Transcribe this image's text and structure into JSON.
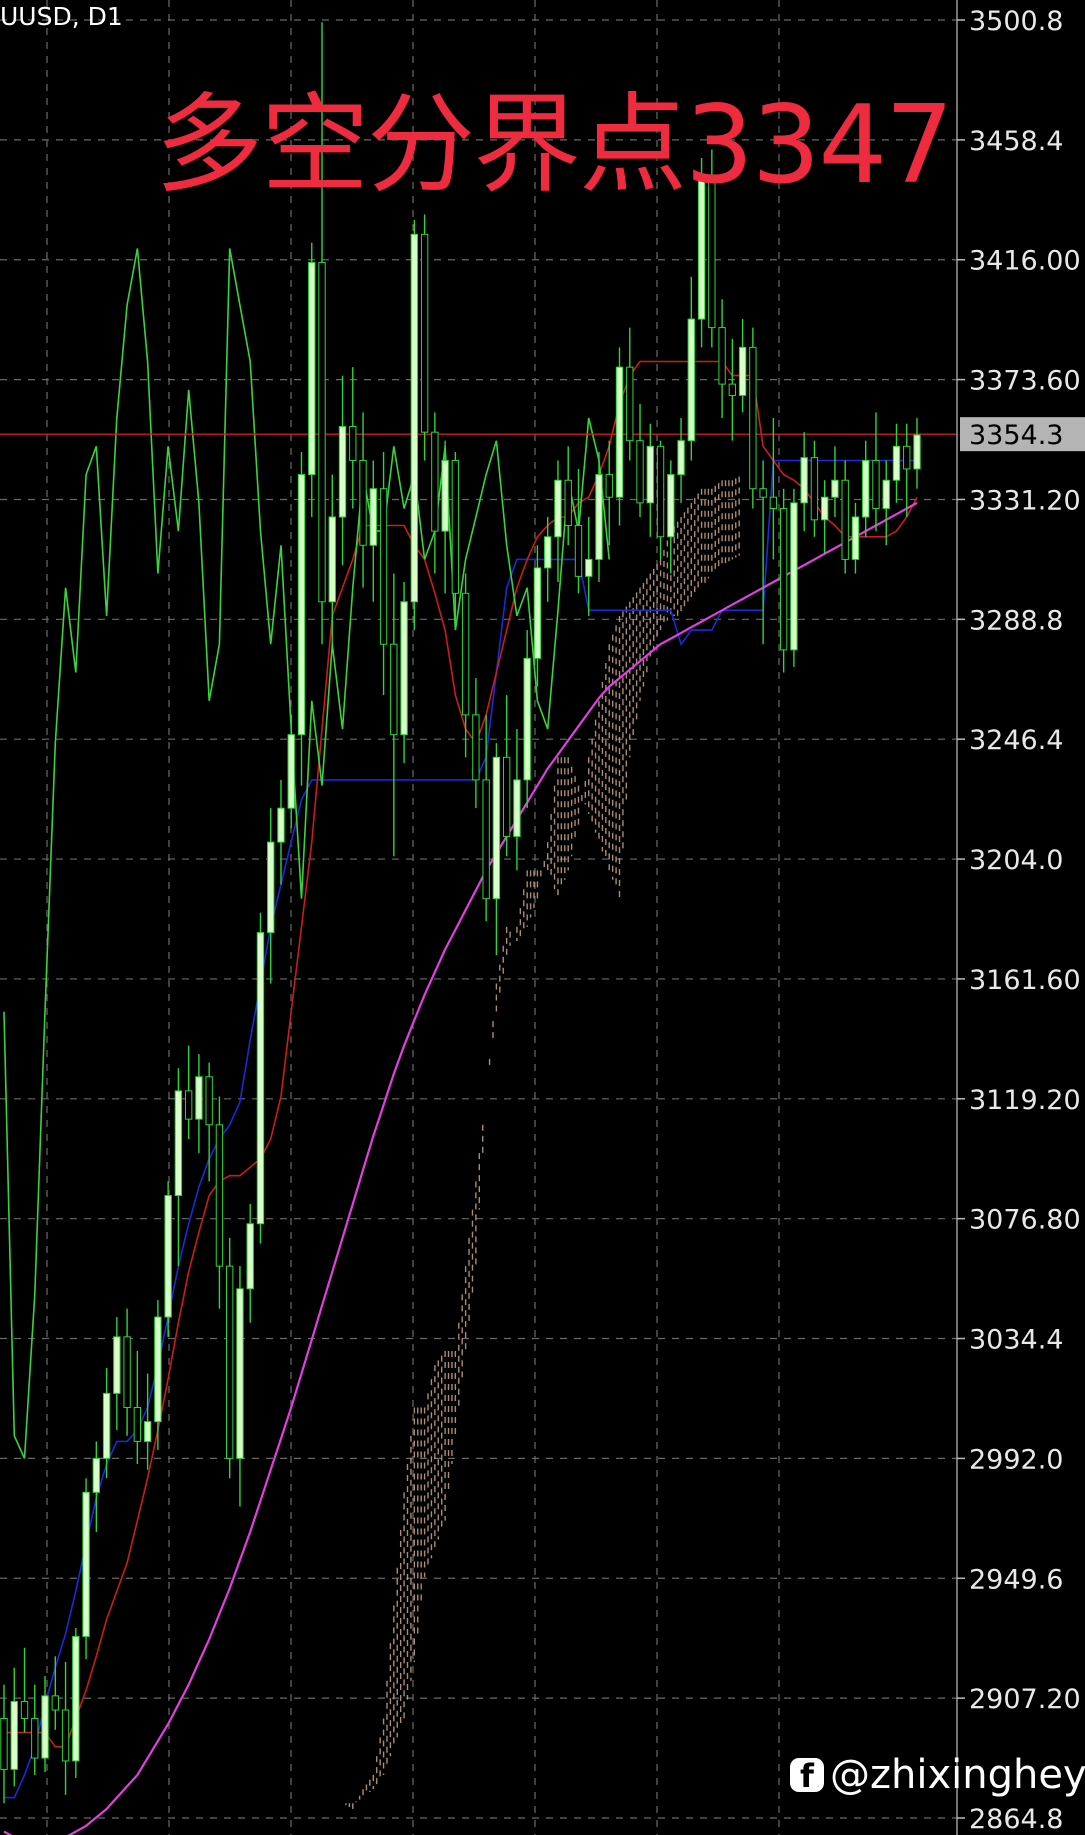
{
  "header": {
    "symbol": "UUSD, D1"
  },
  "annotation": {
    "headline": "多空分界点3347"
  },
  "watermark": {
    "icon": "facebook-icon",
    "handle": "@zhixingheyi"
  },
  "colors": {
    "background": "#000000",
    "grid": "#6a6a6a",
    "bull_candle": "#d8ffc8",
    "candle_wick": "#32d23c",
    "tenkan": "#1a2bd8",
    "kijun": "#c81e1e",
    "senkou_b": "#e040e0",
    "chikou": "#3cd23c",
    "cloud": "#c9a58c",
    "price_line": "#c81e1e",
    "headline": "#ee2b3f"
  },
  "chart_data": {
    "type": "candlestick",
    "timeframe": "D1",
    "ylim": [
      2864.8,
      3500.8
    ],
    "yticks": [
      "3500.8",
      "3458.4",
      "3416.00",
      "3373.60",
      "3331.20",
      "3288.8",
      "3246.4",
      "3204.0",
      "3161.60",
      "3119.20",
      "3076.80",
      "3034.4",
      "2992.0",
      "2949.6",
      "2907.20",
      "2864.8"
    ],
    "current_price_label": "3354.3",
    "current_price": 3354.3,
    "key_level": 3347,
    "candles": [
      [
        2900,
        2912,
        2870,
        2882
      ],
      [
        2882,
        2918,
        2876,
        2906
      ],
      [
        2906,
        2925,
        2895,
        2900
      ],
      [
        2900,
        2912,
        2880,
        2886
      ],
      [
        2886,
        2915,
        2881,
        2908
      ],
      [
        2908,
        2922,
        2896,
        2903
      ],
      [
        2903,
        2920,
        2873,
        2885
      ],
      [
        2885,
        2932,
        2879,
        2929
      ],
      [
        2929,
        2985,
        2921,
        2980
      ],
      [
        2980,
        2998,
        2966,
        2992
      ],
      [
        2992,
        3024,
        2985,
        3015
      ],
      [
        3015,
        3042,
        3002,
        3035
      ],
      [
        3035,
        3045,
        3000,
        3010
      ],
      [
        3010,
        3030,
        2990,
        2998
      ],
      [
        2998,
        3022,
        2988,
        3005
      ],
      [
        3005,
        3048,
        2995,
        3042
      ],
      [
        3042,
        3090,
        3035,
        3085
      ],
      [
        3085,
        3130,
        3060,
        3122
      ],
      [
        3122,
        3138,
        3105,
        3112
      ],
      [
        3112,
        3135,
        3100,
        3127
      ],
      [
        3127,
        3132,
        3090,
        3110
      ],
      [
        3110,
        3120,
        3045,
        3060
      ],
      [
        3060,
        3070,
        2985,
        2992
      ],
      [
        2992,
        3060,
        2975,
        3052
      ],
      [
        3052,
        3082,
        3040,
        3075
      ],
      [
        3075,
        3185,
        3068,
        3178
      ],
      [
        3178,
        3222,
        3160,
        3210
      ],
      [
        3210,
        3232,
        3195,
        3222
      ],
      [
        3222,
        3255,
        3215,
        3248
      ],
      [
        3248,
        3348,
        3230,
        3340
      ],
      [
        3340,
        3422,
        3325,
        3415
      ],
      [
        3415,
        3500,
        3280,
        3295
      ],
      [
        3295,
        3340,
        3278,
        3325
      ],
      [
        3325,
        3375,
        3308,
        3357
      ],
      [
        3357,
        3378,
        3328,
        3345
      ],
      [
        3345,
        3362,
        3300,
        3315
      ],
      [
        3315,
        3345,
        3295,
        3335
      ],
      [
        3335,
        3348,
        3262,
        3280
      ],
      [
        3280,
        3305,
        3205,
        3248
      ],
      [
        3248,
        3302,
        3238,
        3295
      ],
      [
        3295,
        3430,
        3285,
        3425
      ],
      [
        3425,
        3432,
        3345,
        3355
      ],
      [
        3355,
        3362,
        3305,
        3320
      ],
      [
        3320,
        3352,
        3298,
        3345
      ],
      [
        3345,
        3348,
        3288,
        3298
      ],
      [
        3298,
        3305,
        3240,
        3255
      ],
      [
        3255,
        3268,
        3222,
        3232
      ],
      [
        3232,
        3255,
        3182,
        3190
      ],
      [
        3190,
        3245,
        3170,
        3240
      ],
      [
        3240,
        3262,
        3205,
        3212
      ],
      [
        3212,
        3250,
        3200,
        3232
      ],
      [
        3232,
        3285,
        3222,
        3275
      ],
      [
        3275,
        3315,
        3265,
        3307
      ],
      [
        3307,
        3325,
        3295,
        3318
      ],
      [
        3318,
        3345,
        3302,
        3338
      ],
      [
        3338,
        3350,
        3315,
        3322
      ],
      [
        3322,
        3342,
        3298,
        3304
      ],
      [
        3304,
        3325,
        3290,
        3310
      ],
      [
        3310,
        3348,
        3302,
        3340
      ],
      [
        3340,
        3352,
        3315,
        3332
      ],
      [
        3332,
        3385,
        3322,
        3378
      ],
      [
        3378,
        3392,
        3345,
        3352
      ],
      [
        3352,
        3365,
        3325,
        3330
      ],
      [
        3330,
        3358,
        3318,
        3350
      ],
      [
        3350,
        3352,
        3310,
        3318
      ],
      [
        3318,
        3345,
        3305,
        3340
      ],
      [
        3340,
        3360,
        3330,
        3352
      ],
      [
        3352,
        3410,
        3345,
        3395
      ],
      [
        3395,
        3452,
        3385,
        3446
      ],
      [
        3446,
        3455,
        3385,
        3392
      ],
      [
        3392,
        3402,
        3360,
        3372
      ],
      [
        3372,
        3388,
        3352,
        3368
      ],
      [
        3368,
        3395,
        3362,
        3385
      ],
      [
        3385,
        3392,
        3328,
        3335
      ],
      [
        3335,
        3345,
        3280,
        3332
      ],
      [
        3332,
        3360,
        3310,
        3328
      ],
      [
        3328,
        3335,
        3270,
        3278
      ],
      [
        3278,
        3335,
        3272,
        3330
      ],
      [
        3330,
        3355,
        3320,
        3346
      ],
      [
        3346,
        3352,
        3318,
        3324
      ],
      [
        3324,
        3338,
        3312,
        3332
      ],
      [
        3332,
        3350,
        3325,
        3338
      ],
      [
        3338,
        3345,
        3305,
        3310
      ],
      [
        3310,
        3330,
        3305,
        3325
      ],
      [
        3325,
        3352,
        3318,
        3345
      ],
      [
        3345,
        3362,
        3320,
        3328
      ],
      [
        3328,
        3345,
        3315,
        3338
      ],
      [
        3338,
        3358,
        3330,
        3350
      ],
      [
        3350,
        3358,
        3325,
        3342
      ],
      [
        3342,
        3360,
        3335,
        3354
      ]
    ],
    "series": [
      {
        "key": "tenkan",
        "values": [
          2872,
          2872,
          2880,
          2890,
          2905,
          2918,
          2930,
          2945,
          2962,
          2978,
          2990,
          2998,
          2998,
          3002,
          3010,
          3025,
          3042,
          3060,
          3075,
          3088,
          3098,
          3105,
          3110,
          3118,
          3140,
          3160,
          3180,
          3195,
          3210,
          3225,
          3232,
          3232,
          3232,
          3232,
          3232,
          3232,
          3232,
          3232,
          3232,
          3232,
          3232,
          3232,
          3232,
          3232,
          3232,
          3232,
          3232,
          3240,
          3270,
          3300,
          3310,
          3310,
          3310,
          3310,
          3310,
          3310,
          3310,
          3292,
          3292,
          3292,
          3292,
          3292,
          3292,
          3292,
          3292,
          3292,
          3280,
          3285,
          3285,
          3285,
          3292,
          3292,
          3292,
          3292,
          3292,
          3345,
          3345,
          3345,
          3345,
          3345,
          3345,
          3345,
          3345,
          3345,
          3345,
          3345,
          3345,
          3345,
          3345,
          3345
        ]
      },
      {
        "key": "kijun",
        "values": [
          2895,
          2895,
          2895,
          2895,
          2895,
          2890,
          2890,
          2900,
          2910,
          2922,
          2935,
          2945,
          2955,
          2970,
          2985,
          3002,
          3020,
          3040,
          3058,
          3072,
          3085,
          3090,
          3092,
          3092,
          3095,
          3098,
          3105,
          3120,
          3150,
          3180,
          3210,
          3250,
          3290,
          3300,
          3310,
          3322,
          3322,
          3322,
          3322,
          3322,
          3315,
          3310,
          3298,
          3285,
          3262,
          3250,
          3245,
          3255,
          3270,
          3285,
          3300,
          3310,
          3318,
          3322,
          3325,
          3325,
          3330,
          3332,
          3340,
          3350,
          3365,
          3375,
          3380,
          3380,
          3380,
          3380,
          3380,
          3380,
          3380,
          3380,
          3380,
          3375,
          3375,
          3375,
          3350,
          3345,
          3340,
          3338,
          3335,
          3330,
          3325,
          3322,
          3318,
          3318,
          3318,
          3318,
          3318,
          3320,
          3325,
          3332
        ]
      },
      {
        "key": "senkou_b",
        "values": [
          2860,
          2858,
          2856,
          2855,
          2855,
          2856,
          2858,
          2860,
          2862,
          2865,
          2868,
          2872,
          2876,
          2880,
          2886,
          2892,
          2898,
          2905,
          2912,
          2920,
          2928,
          2937,
          2946,
          2956,
          2966,
          2977,
          2988,
          2999,
          3010,
          3022,
          3034,
          3046,
          3058,
          3070,
          3082,
          3094,
          3106,
          3117,
          3128,
          3138,
          3147,
          3156,
          3164,
          3172,
          3179,
          3186,
          3193,
          3200,
          3206,
          3212,
          3218,
          3224,
          3230,
          3236,
          3241,
          3246,
          3251,
          3256,
          3261,
          3265,
          3268,
          3271,
          3274,
          3277,
          3280,
          3282,
          3284,
          3286,
          3288,
          3290,
          3292,
          3294,
          3296,
          3298,
          3300,
          3302,
          3304,
          3306,
          3308,
          3310,
          3312,
          3314,
          3316,
          3318,
          3320,
          3322,
          3324,
          3326,
          3328,
          3330
        ]
      },
      {
        "key": "chikou",
        "values": [
          3150,
          3000,
          2992,
          3050,
          3150,
          3245,
          3300,
          3270,
          3340,
          3350,
          3290,
          3360,
          3400,
          3420,
          3380,
          3305,
          3350,
          3320,
          3370,
          3330,
          3260,
          3280,
          3420,
          3400,
          3380,
          3320,
          3280,
          3315,
          3250,
          3190,
          3260,
          3230,
          3280,
          3250,
          3300,
          3340,
          3320,
          3320,
          3350,
          3328,
          3340,
          3310,
          3320,
          3350,
          3285,
          3310,
          3325,
          3340,
          3352,
          3315,
          3290,
          3300,
          3260,
          3250,
          3292,
          3338,
          3320,
          3360,
          3345,
          3310
        ]
      }
    ],
    "cloud": {
      "start_index": 33,
      "span_a": [
        2870,
        2868,
        2875,
        2880,
        2900,
        2940,
        2980,
        3010,
        3010,
        3025,
        3030,
        3030,
        3060,
        3090,
        3120,
        3160,
        3180,
        3175,
        3180,
        3190,
        3210,
        3240,
        3240,
        3230,
        3220,
        3210,
        3200,
        3190,
        3240,
        3260,
        3275,
        3285,
        3290,
        3290,
        3295,
        3300,
        3305,
        3308,
        3310,
        3312
      ],
      "span_b": [
        2870,
        2870,
        2872,
        2875,
        2880,
        2890,
        2900,
        2920,
        2950,
        2960,
        2970,
        3000,
        3030,
        3060,
        3120,
        3150,
        3170,
        3180,
        3200,
        3200,
        3200,
        3190,
        3200,
        3215,
        3240,
        3260,
        3280,
        3290,
        3295,
        3300,
        3305,
        3310,
        3320,
        3325,
        3330,
        3335,
        3335,
        3338,
        3338,
        3340
      ]
    },
    "xlabel": "",
    "ylabel": ""
  }
}
